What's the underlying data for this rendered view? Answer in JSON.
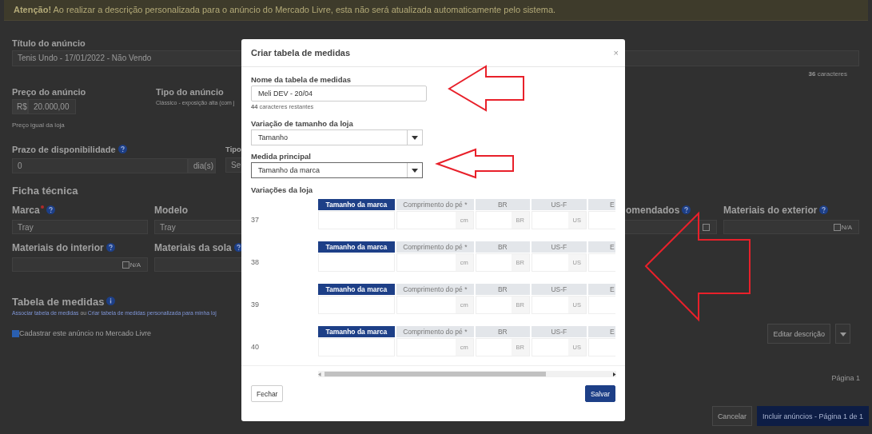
{
  "notice": {
    "text": "**Atenção!** Ao realizar a descrição personalizada para o anúncio do Mercado Livre, esta não será atualizada automaticamente pelo sistema."
  },
  "listing": {
    "title_label": "Título do anúncio",
    "title_value": "Tenis Undo - 17/01/2022 - Não Vendo",
    "title_count": "**36** caracteres",
    "price_label": "Preço do anúncio",
    "price_prefix": "R$",
    "price_value": "20.000,00",
    "price_hint": "Preço igual da loja",
    "type_label": "Tipo do anúncio",
    "type_value": "Clássico - exposição alta (com j",
    "availability_label": "Prazo de disponibilidade",
    "availability_value": "0",
    "availability_suffix": "dia(s)",
    "shipping_label": "Tipo",
    "shipping_value": "Se"
  },
  "specs": {
    "heading": "Ficha técnica",
    "fields": [
      {
        "label": "Marca",
        "required": true,
        "help": true,
        "value": "Tray",
        "kind": "text"
      },
      {
        "label": "Modelo",
        "required": false,
        "help": false,
        "value": "Tray",
        "kind": "text"
      },
      {
        "label": "omendados",
        "required": false,
        "help": true,
        "kind": "na",
        "checked": false
      },
      {
        "label": "Materiais do exterior",
        "required": false,
        "help": true,
        "kind": "na",
        "checked": false,
        "na_label": "N/A"
      },
      {
        "label": "Materiais do interior",
        "required": false,
        "help": true,
        "kind": "na",
        "checked": false,
        "na_label": "N/A"
      },
      {
        "label": "Materiais da sola",
        "required": false,
        "help": true,
        "kind": "text"
      }
    ]
  },
  "size_chart": {
    "heading": "Tabela de medidas",
    "link_1": "Associar tabela de medidas",
    "joiner": "ou",
    "link_2": "Criar tabela de medidas personalizada para minha loj"
  },
  "publish": {
    "label": "Cadastrar este anúncio no Mercado Livre",
    "checked": true
  },
  "actions": {
    "edit": "Editar descrição",
    "pager": "Página 1",
    "cancel": "Cancelar",
    "submit": "Incluir anúncios - Página 1 de 1"
  },
  "modal": {
    "title": "Criar tabela de medidas",
    "close": "×",
    "name_label": "Nome da tabela de medidas",
    "name_value": "Meli DEV - 20/04",
    "name_hint": "**44** caracteres restantes",
    "variation_label": "Variação de tamanho da loja",
    "variation_value": "Tamanho",
    "main_label": "Medida principal",
    "main_value": "Tamanho da marca",
    "rows_label": "Variações da loja",
    "rows": [
      {
        "size": "37",
        "columns": [
          {
            "header": "Tamanho da marca",
            "selected": true
          },
          {
            "header": "Comprimento do pé *",
            "selected": false,
            "unit": "cm"
          },
          {
            "header": "BR",
            "selected": false,
            "unit": "BR"
          },
          {
            "header": "US-F",
            "selected": false,
            "unit": "US"
          },
          {
            "header": "E",
            "selected": false
          }
        ]
      },
      {
        "size": "38",
        "columns": [
          {
            "header": "Tamanho da marca",
            "selected": true
          },
          {
            "header": "Comprimento do pé *",
            "selected": false,
            "unit": "cm"
          },
          {
            "header": "BR",
            "selected": false,
            "unit": "BR"
          },
          {
            "header": "US-F",
            "selected": false,
            "unit": "US"
          },
          {
            "header": "E",
            "selected": false
          }
        ]
      },
      {
        "size": "39",
        "columns": [
          {
            "header": "Tamanho da marca",
            "selected": true
          },
          {
            "header": "Comprimento do pé *",
            "selected": false,
            "unit": "cm"
          },
          {
            "header": "BR",
            "selected": false,
            "unit": "BR"
          },
          {
            "header": "US-F",
            "selected": false,
            "unit": "US"
          },
          {
            "header": "E",
            "selected": false
          }
        ]
      },
      {
        "size": "40",
        "columns": [
          {
            "header": "Tamanho da marca",
            "selected": true
          },
          {
            "header": "Comprimento do pé *",
            "selected": false,
            "unit": "cm"
          },
          {
            "header": "BR",
            "selected": false,
            "unit": "BR"
          },
          {
            "header": "US-F",
            "selected": false,
            "unit": "US"
          },
          {
            "header": "E",
            "selected": false
          }
        ]
      }
    ],
    "close_button": "Fechar",
    "save_button": "Salvar"
  }
}
